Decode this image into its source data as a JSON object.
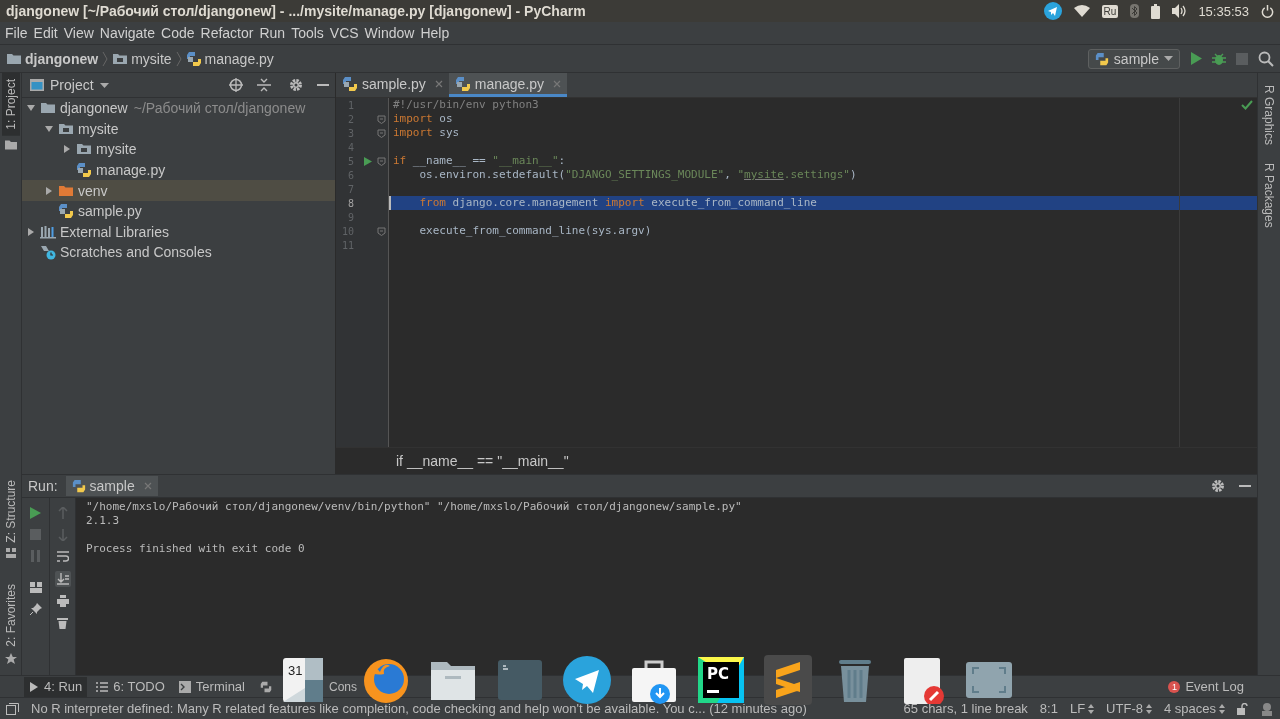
{
  "title_bar": {
    "title": "djangonew [~/Рабочий стол/djangonew] - .../mysite/manage.py [djangonew] - PyCharm",
    "keyboard_layout": "Ru",
    "clock": "15:35:53"
  },
  "menu": [
    "File",
    "Edit",
    "View",
    "Navigate",
    "Code",
    "Refactor",
    "Run",
    "Tools",
    "VCS",
    "Window",
    "Help"
  ],
  "nav_bar": {
    "breadcrumbs": [
      {
        "label": "djangonew",
        "kind": "folder"
      },
      {
        "label": "mysite",
        "kind": "module"
      },
      {
        "label": "manage.py",
        "kind": "python"
      }
    ],
    "run_config": "sample",
    "stop_disabled": true
  },
  "left_stripe": {
    "top": [
      {
        "label": "1: Project",
        "selected": true
      }
    ],
    "bottom": [
      {
        "label": "Z: Structure",
        "selected": false
      },
      {
        "label": "2: Favorites",
        "selected": false
      }
    ]
  },
  "right_stripe": [
    "R Graphics",
    "R Packages"
  ],
  "project": {
    "title": "Project",
    "tree": [
      {
        "label": "djangonew",
        "hint": "~/Рабочий стол/djangonew",
        "kind": "folder",
        "expanded": true,
        "selected": false,
        "children": [
          {
            "label": "mysite",
            "kind": "module",
            "expanded": true,
            "selected": false,
            "children": [
              {
                "label": "mysite",
                "kind": "module",
                "expanded": false,
                "selected": false
              },
              {
                "label": "manage.py",
                "kind": "python",
                "selected": false
              }
            ]
          },
          {
            "label": "venv",
            "kind": "excluded",
            "expanded": false,
            "selected": true
          },
          {
            "label": "sample.py",
            "kind": "python",
            "selected": false
          }
        ]
      },
      {
        "label": "External Libraries",
        "kind": "libraries",
        "expanded": false,
        "selected": false
      },
      {
        "label": "Scratches and Consoles",
        "kind": "scratches",
        "selected": false
      }
    ]
  },
  "editor": {
    "tabs": [
      {
        "label": "sample.py",
        "selected": false
      },
      {
        "label": "manage.py",
        "selected": true
      }
    ],
    "lines": [
      {
        "number": "1",
        "fold": false,
        "run": false,
        "selected": false,
        "tokens": [
          {
            "kind": "comment",
            "text": "#!/usr/bin/env python3"
          }
        ]
      },
      {
        "number": "2",
        "fold": true,
        "run": false,
        "selected": false,
        "tokens": [
          {
            "kind": "keyword",
            "text": "import"
          },
          {
            "kind": "plain",
            "text": " os"
          }
        ]
      },
      {
        "number": "3",
        "fold": true,
        "run": false,
        "selected": false,
        "tokens": [
          {
            "kind": "keyword",
            "text": "import"
          },
          {
            "kind": "plain",
            "text": " sys"
          }
        ]
      },
      {
        "number": "4",
        "fold": false,
        "run": false,
        "selected": false
      },
      {
        "number": "5",
        "fold": true,
        "run": true,
        "selected": false,
        "tokens": [
          {
            "kind": "keyword",
            "text": "if"
          },
          {
            "kind": "plain",
            "text": " __name__ == "
          },
          {
            "kind": "string",
            "text": "\"__main__\""
          },
          {
            "kind": "plain",
            "text": ":"
          }
        ]
      },
      {
        "number": "6",
        "fold": false,
        "run": false,
        "selected": false,
        "tokens": [
          {
            "kind": "plain",
            "text": "    os.environ.setdefault("
          },
          {
            "kind": "string",
            "text": "\"DJANGO_SETTINGS_MODULE\""
          },
          {
            "kind": "plain",
            "text": ", "
          },
          {
            "kind": "string",
            "text": "\""
          },
          {
            "kind": "typo",
            "text": "mysite"
          },
          {
            "kind": "string",
            "text": ".settings\""
          },
          {
            "kind": "plain",
            "text": ")"
          }
        ]
      },
      {
        "number": "7",
        "fold": false,
        "run": false,
        "selected": false
      },
      {
        "number": "8",
        "fold": false,
        "run": false,
        "selected": true,
        "tokens": [
          {
            "kind": "keyword",
            "text": "    from"
          },
          {
            "kind": "plain",
            "text": " django.core.management "
          },
          {
            "kind": "keyword",
            "text": "import"
          },
          {
            "kind": "plain",
            "text": " execute_from_command_line"
          }
        ]
      },
      {
        "number": "9",
        "fold": false,
        "run": false,
        "selected": false
      },
      {
        "number": "10",
        "fold": true,
        "run": false,
        "selected": false,
        "tokens": [
          {
            "kind": "plain",
            "text": "    execute_from_command_line(sys.argv)"
          }
        ]
      },
      {
        "number": "11",
        "fold": false,
        "run": false,
        "selected": false
      }
    ],
    "breadcrumb": "if __name__ == \"__main__\""
  },
  "run_panel": {
    "label": "Run:",
    "tab": "sample",
    "output": [
      [
        "\"/home/mxslo/Рабочий стол/djangonew/venv/bin/python\" \"/home/mxslo/Рабочий стол/djangonew/sample.py\"",
        "2.1.3"
      ],
      [
        "Process finished with exit code 0"
      ]
    ]
  },
  "tool_tabs": [
    {
      "label": "4: Run",
      "kind": "run",
      "selected": true
    },
    {
      "label": "6: TODO",
      "kind": "todo",
      "selected": false
    },
    {
      "label": "Terminal",
      "kind": "terminal",
      "selected": false
    },
    {
      "label": "Cons",
      "kind": "python",
      "selected": false
    }
  ],
  "event_log": {
    "label": "Event Log",
    "count": "1"
  },
  "status_bar": {
    "message": "No R interpreter defined: Many R related features like completion, code checking and help won't be available. You c... (12 minutes ago)",
    "items": [
      {
        "text": "65 chars, 1 line break",
        "kind": "plain"
      },
      {
        "text": "8:1",
        "kind": "plain"
      },
      {
        "text": "LF",
        "kind": "select"
      },
      {
        "text": "UTF-8",
        "kind": "select"
      },
      {
        "text": "4 spaces",
        "kind": "select"
      }
    ]
  },
  "dock": [
    {
      "kind": "calendar",
      "label": "31",
      "selected": false
    },
    {
      "kind": "browser",
      "selected": false
    },
    {
      "kind": "files",
      "selected": false
    },
    {
      "kind": "terminal",
      "selected": false
    },
    {
      "kind": "messenger",
      "selected": false
    },
    {
      "kind": "store",
      "selected": false
    },
    {
      "kind": "ide",
      "label": "PC",
      "selected": false
    },
    {
      "kind": "sublime",
      "selected": true
    },
    {
      "kind": "trash",
      "selected": false
    },
    {
      "kind": "editor",
      "selected": false
    },
    {
      "kind": "screenshot",
      "selected": false
    }
  ]
}
